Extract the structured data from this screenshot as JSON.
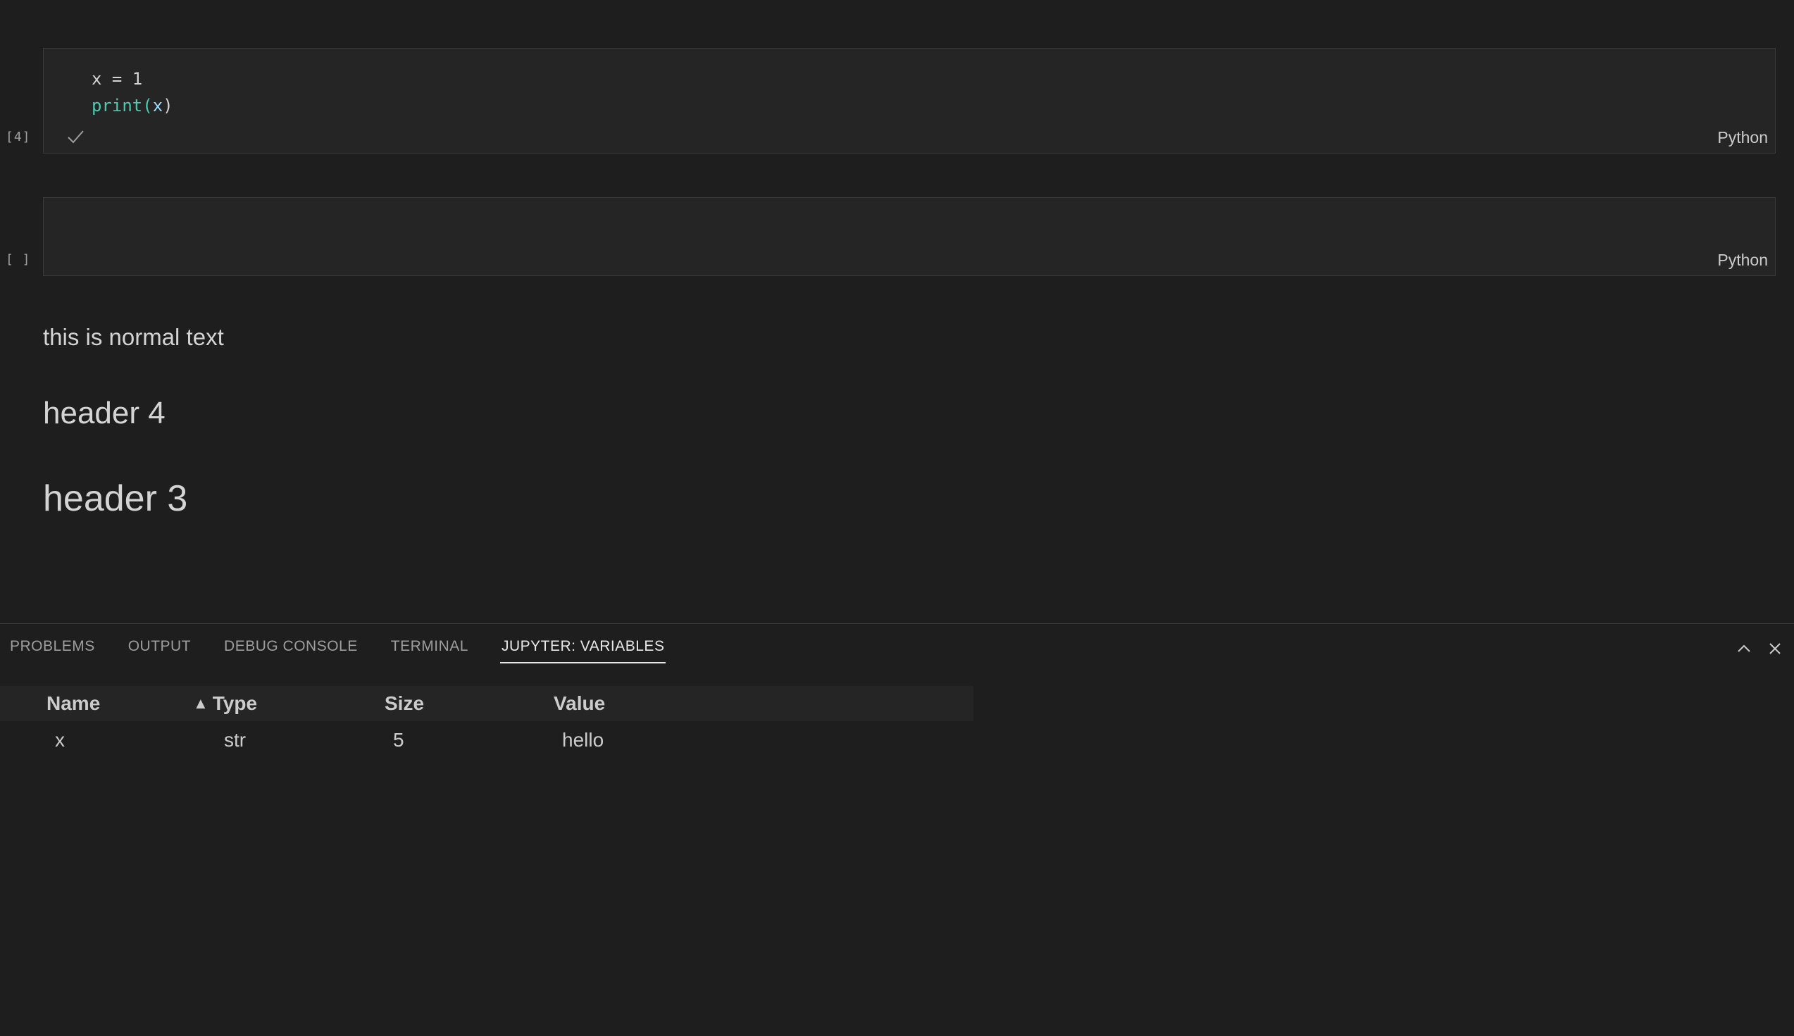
{
  "notebook": {
    "cells": [
      {
        "exec_count": "[4]",
        "code_line_1": "x = 1",
        "code_fn": "print",
        "code_open": "(",
        "code_arg": "x",
        "code_close": ")",
        "language": "Python",
        "status_icon": "check-icon"
      },
      {
        "exec_count": "[ ]",
        "language": "Python"
      }
    ],
    "markdown": {
      "paragraph": "this is normal text",
      "header4": "header 4",
      "header3": "header 3"
    }
  },
  "panel": {
    "tabs": [
      {
        "label": "PROBLEMS",
        "active": false
      },
      {
        "label": "OUTPUT",
        "active": false
      },
      {
        "label": "DEBUG CONSOLE",
        "active": false
      },
      {
        "label": "TERMINAL",
        "active": false
      },
      {
        "label": "JUPYTER: VARIABLES",
        "active": true
      }
    ],
    "actions": [
      "chevron-up-icon",
      "close-icon"
    ],
    "variables": {
      "sort_indicator": "▲",
      "headers": [
        "Name",
        "Type",
        "Size",
        "Value"
      ],
      "rows": [
        {
          "name": "x",
          "type": "str",
          "size": "5",
          "value": "hello"
        }
      ]
    }
  }
}
